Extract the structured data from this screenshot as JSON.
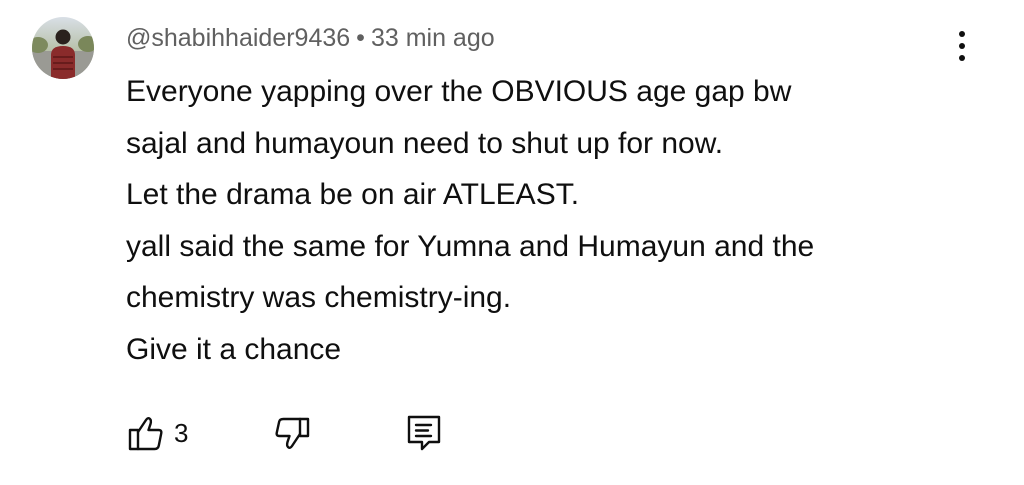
{
  "comment": {
    "author": "@shabihhaider9436",
    "separator": "•",
    "time": "33 min ago",
    "lines": [
      "Everyone yapping over the OBVIOUS age gap bw",
      "sajal and humayoun need to shut up for now.",
      "Let the drama be on air ATLEAST.",
      "yall said the same for Yumna and Humayun and the",
      "chemistry was chemistry-ing.",
      "Give it a chance"
    ],
    "likes": "3"
  },
  "icons": {
    "more": "more-vertical-icon",
    "like": "thumbs-up-icon",
    "dislike": "thumbs-down-icon",
    "reply": "reply-comment-icon"
  },
  "colors": {
    "text": "#0f0f0f",
    "meta": "#606060"
  }
}
